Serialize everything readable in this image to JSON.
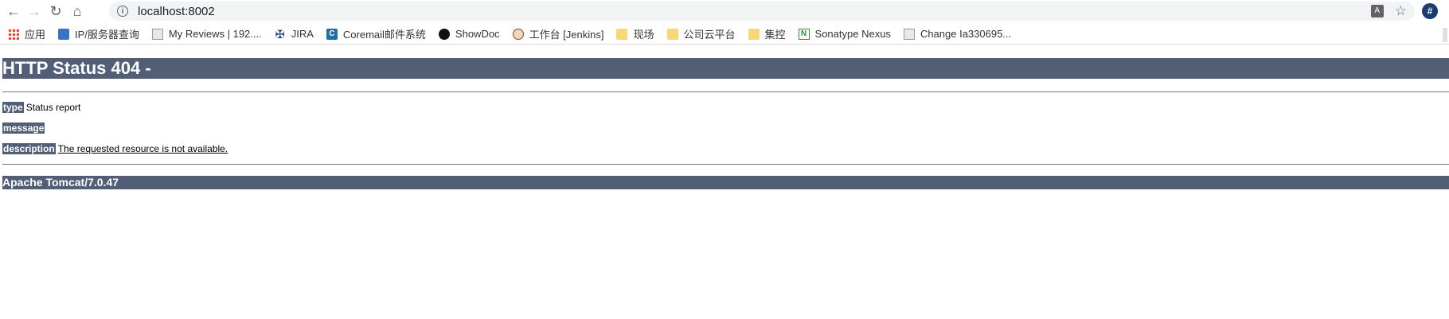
{
  "browser": {
    "url": "localhost:8002",
    "back_icon": "back-arrow-icon",
    "forward_icon": "forward-arrow-icon",
    "reload_icon": "reload-icon",
    "home_icon": "home-icon",
    "extension_label": "#"
  },
  "bookmarks": [
    {
      "label": "应用",
      "icon": "apps-grid-icon"
    },
    {
      "label": "IP/服务器查询",
      "icon": "ip-query-icon"
    },
    {
      "label": "My Reviews | 192....",
      "icon": "review-icon"
    },
    {
      "label": "JIRA",
      "icon": "jira-icon"
    },
    {
      "label": "Coremail邮件系统",
      "icon": "coremail-icon"
    },
    {
      "label": "ShowDoc",
      "icon": "showdoc-icon"
    },
    {
      "label": "工作台 [Jenkins]",
      "icon": "jenkins-icon"
    },
    {
      "label": "现场",
      "icon": "folder-icon"
    },
    {
      "label": "公司云平台",
      "icon": "folder-icon"
    },
    {
      "label": "集控",
      "icon": "folder-icon"
    },
    {
      "label": "Sonatype Nexus",
      "icon": "nexus-icon"
    },
    {
      "label": "Change Ia330695...",
      "icon": "review-icon"
    }
  ],
  "page": {
    "heading": "HTTP Status 404 -",
    "type_key": "type",
    "type_value": "Status report",
    "message_key": "message",
    "message_value": "",
    "description_key": "description",
    "description_value": "The requested resource is not available.",
    "footer": "Apache Tomcat/7.0.47"
  },
  "colors": {
    "tomcat_bar": "#525d76",
    "omnibox_bg": "#f1f3f4"
  }
}
